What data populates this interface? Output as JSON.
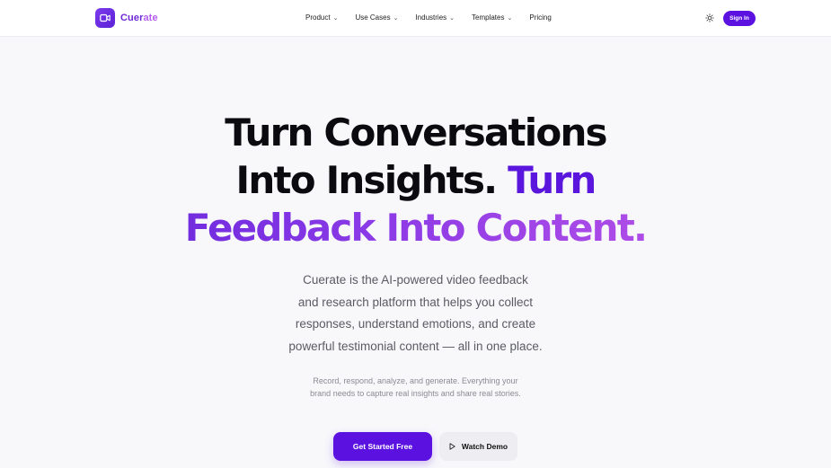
{
  "brand": {
    "name_main": "Cuer",
    "name_tail": "ate"
  },
  "nav": {
    "items": [
      {
        "label": "Product",
        "has_dropdown": true
      },
      {
        "label": "Use Cases",
        "has_dropdown": true
      },
      {
        "label": "Industries",
        "has_dropdown": true
      },
      {
        "label": "Templates",
        "has_dropdown": true
      },
      {
        "label": "Pricing",
        "has_dropdown": false
      }
    ],
    "chevron": "⌄",
    "theme_icon": "sun-icon",
    "sign_in_label": "Sign In"
  },
  "hero": {
    "title_line1": "Turn Conversations",
    "title_line2_a": "Into Insights. ",
    "title_line2_b": "Turn",
    "title_line3": "Feedback Into Content.",
    "lead": [
      "Cuerate is the AI-powered video feedback",
      "and research platform that helps you collect",
      "responses, understand emotions, and create",
      "powerful testimonial content — all in one place."
    ],
    "sub": [
      "Record, respond, analyze, and generate. Everything your",
      "brand needs to capture real insights and share real stories."
    ],
    "cta_primary": "Get Started Free",
    "cta_secondary": "Watch Demo",
    "cta_secondary_icon": "play-icon"
  },
  "colors": {
    "accent": "#5b12e0",
    "gradient_start": "#5a20d8",
    "gradient_end": "#c659e8",
    "background": "#f8f8fb"
  }
}
